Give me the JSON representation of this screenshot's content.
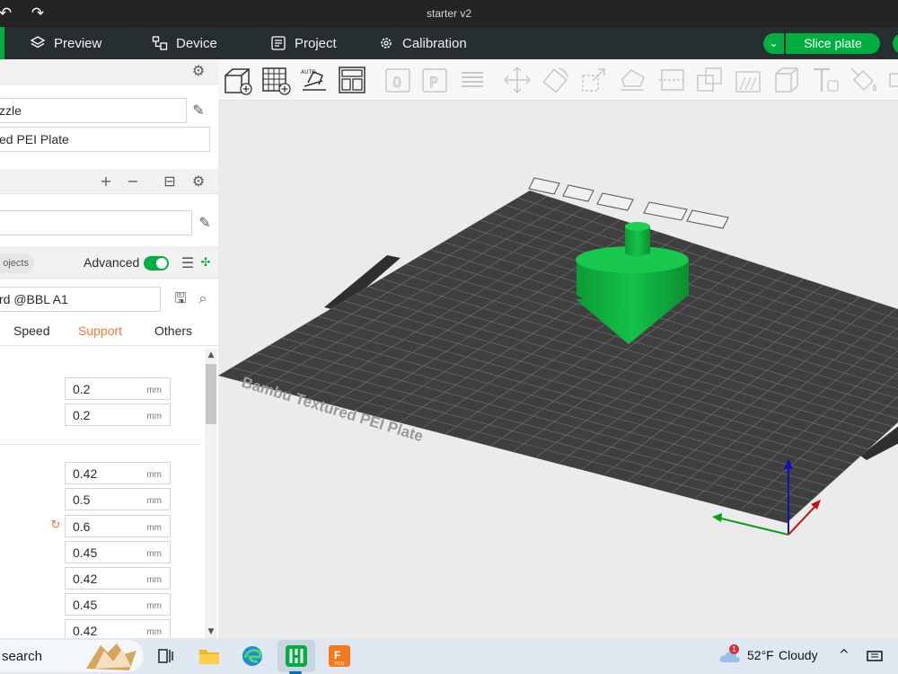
{
  "window": {
    "title": "starter v2",
    "back_icon": "undo-arrow-icon",
    "forward_icon": "redo-arrow-icon"
  },
  "nav": {
    "tabs": [
      {
        "label": "Preview",
        "icon": "layers-icon"
      },
      {
        "label": "Device",
        "icon": "device-icon"
      },
      {
        "label": "Project",
        "icon": "project-icon"
      },
      {
        "label": "Calibration",
        "icon": "calibration-gear-icon"
      }
    ],
    "slice_button": "Slice plate",
    "accent_color": "#00ae42"
  },
  "left_panel": {
    "nozzle_field": "zzle",
    "plate_field": "ed PEI Plate",
    "objects_pill": "ojects",
    "advanced_label": "Advanced",
    "advanced_on": true,
    "process_preset": "rd @BBL A1",
    "tabs": [
      {
        "label": "Speed",
        "active": false
      },
      {
        "label": "Support",
        "active": true
      },
      {
        "label": "Others",
        "active": false
      }
    ],
    "group1": [
      {
        "value": "0.2",
        "unit": "mm"
      },
      {
        "value": "0.2",
        "unit": "mm"
      }
    ],
    "group2": [
      {
        "value": "0.42",
        "unit": "mm"
      },
      {
        "value": "0.5",
        "unit": "mm"
      },
      {
        "value": "0.6",
        "unit": "mm",
        "modified": true
      },
      {
        "value": "0.45",
        "unit": "mm"
      },
      {
        "value": "0.42",
        "unit": "mm"
      },
      {
        "value": "0.45",
        "unit": "mm"
      },
      {
        "value": "0.42",
        "unit": "mm"
      }
    ]
  },
  "viewport": {
    "plate_label": "Bambu Textured PEI Plate",
    "model_color": "#0fae3c",
    "plate_color": "#3d3d3d"
  },
  "taskbar": {
    "search": "search",
    "weather_temp": "52°F",
    "weather_text": "Cloudy",
    "weather_badge": "1",
    "apps": [
      "task-view-icon",
      "file-explorer-icon",
      "edge-icon",
      "bambu-studio-icon",
      "fusion-icon"
    ]
  }
}
